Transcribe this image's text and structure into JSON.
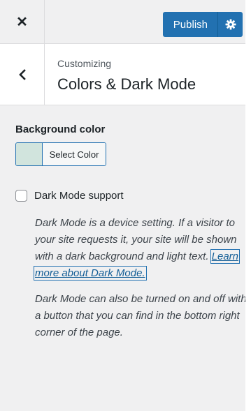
{
  "header": {
    "close_symbol": "✕",
    "publish_label": "Publish",
    "gear_icon": "gear-icon"
  },
  "section": {
    "breadcrumb": "Customizing",
    "title": "Colors & Dark Mode",
    "back_icon": "chevron-left-icon"
  },
  "background_color": {
    "label": "Background color",
    "button_label": "Select Color",
    "swatch_color": "#d1e4dd"
  },
  "dark_mode": {
    "checkbox_label": "Dark Mode support",
    "checked": false,
    "description_1": "Dark Mode is a device setting. If a visitor to your site requests it, your site will be shown with a dark background and light text.",
    "link_text": "Learn more about Dark Mode.",
    "description_2": "Dark Mode can also be turned on and off with a button that you can find in the bottom right corner of the page."
  },
  "colors": {
    "accent": "#2271b1",
    "panel_bg": "#f0f0f1"
  }
}
